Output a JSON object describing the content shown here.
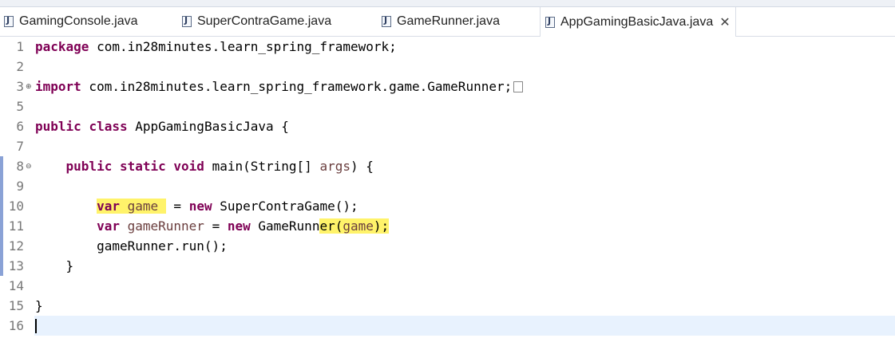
{
  "tabs": [
    {
      "label": "GamingConsole.java",
      "active": false
    },
    {
      "label": "SuperContraGame.java",
      "active": false
    },
    {
      "label": "GameRunner.java",
      "active": false
    },
    {
      "label": "AppGamingBasicJava.java",
      "active": true
    }
  ],
  "close_glyph": "✕",
  "lines": {
    "l1": {
      "num": "1",
      "kw1": "package",
      "rest": " com.in28minutes.learn_spring_framework;"
    },
    "l2": {
      "num": "2"
    },
    "l3": {
      "num": "3",
      "kw1": "import",
      "rest": " com.in28minutes.learn_spring_framework.game.GameRunner;"
    },
    "l5": {
      "num": "5"
    },
    "l6": {
      "num": "6",
      "kw1": "public",
      "kw2": "class",
      "rest": " AppGamingBasicJava {"
    },
    "l7": {
      "num": "7"
    },
    "l8": {
      "num": "8",
      "indent": "    ",
      "kw1": "public",
      "kw2": "static",
      "kw3": "void",
      "rest1": " main(String[] ",
      "param": "args",
      "rest2": ") {"
    },
    "l9": {
      "num": "9"
    },
    "l10": {
      "num": "10",
      "indent": "        ",
      "kw1": "var",
      "var": "game",
      "eq": " = ",
      "kw2": "new",
      "rest": " SuperContraGame();"
    },
    "l11": {
      "num": "11",
      "indent": "        ",
      "kw1": "var",
      "var": "gameRunner",
      "eq": " = ",
      "kw2": "new",
      "rest1": " GameRunn",
      "rest2": "er(",
      "arg": "game",
      "rest3": ");"
    },
    "l12": {
      "num": "12",
      "indent": "        ",
      "rest": "gameRunner.run();"
    },
    "l13": {
      "num": "13",
      "indent": "    ",
      "rest": "}"
    },
    "l14": {
      "num": "14"
    },
    "l15": {
      "num": "15",
      "rest": "}"
    },
    "l16": {
      "num": "16"
    }
  },
  "fold_glyphs": {
    "expand": "⊕",
    "collapse": "⊖"
  }
}
